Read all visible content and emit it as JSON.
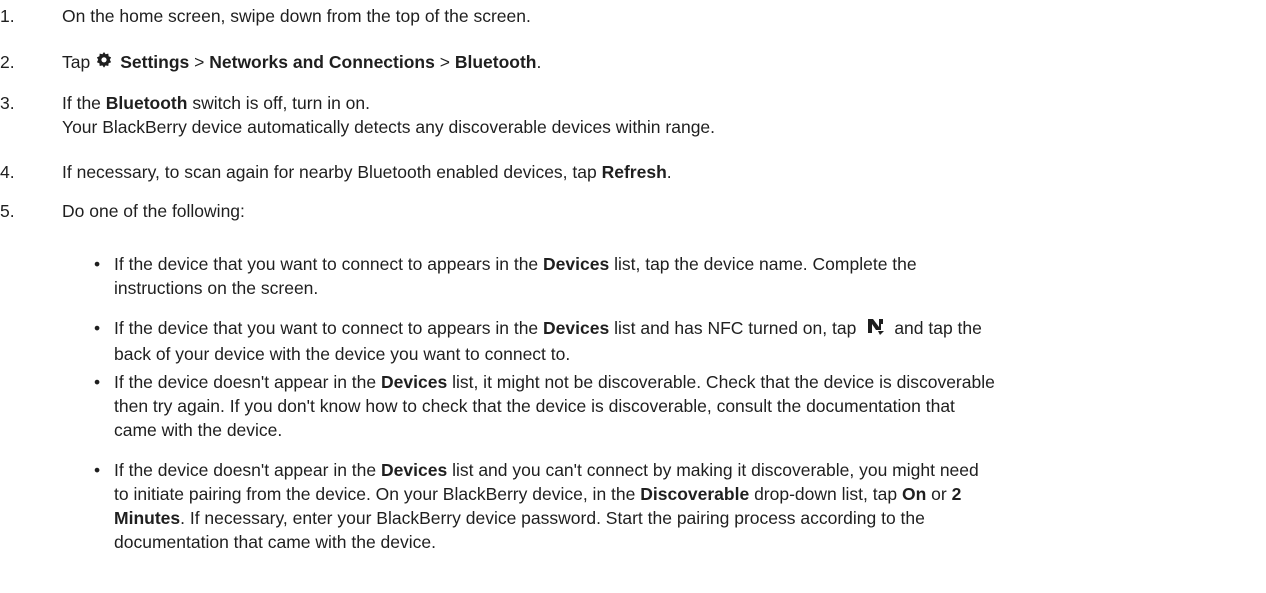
{
  "steps": [
    {
      "num": "1.",
      "text": "On the home screen, swipe down from the top of the screen."
    },
    {
      "num": "2.",
      "parts": [
        "Tap",
        "Settings",
        ">",
        "Networks and Connections",
        ">",
        "Bluetooth",
        "."
      ]
    },
    {
      "num": "3.",
      "parts": [
        "If the",
        "Bluetooth",
        "switch is off, turn in on."
      ],
      "line2": "Your BlackBerry device automatically detects any discoverable devices within range."
    },
    {
      "num": "4.",
      "parts": [
        "If necessary, to scan again for nearby Bluetooth enabled devices, tap",
        "Refresh",
        "."
      ]
    },
    {
      "num": "5.",
      "text": "Do one of the following:"
    }
  ],
  "bullets": [
    {
      "l1": [
        "If the device that you want to connect to appears in the",
        "Devices",
        "list, tap the device name. Complete the"
      ],
      "l2": "instructions on the screen."
    },
    {
      "l1": [
        "If the device that you want to connect to appears in the",
        "Devices",
        "list and has NFC turned on, tap",
        "and tap the"
      ],
      "l2": "back of your device with the device you want to connect to."
    },
    {
      "l1": [
        "If the device doesn't appear in the",
        "Devices",
        "list, it might not be discoverable. Check that the device is discoverable"
      ],
      "l2": "then try again. If you don't know how to check that the device is discoverable, consult the documentation that",
      "l3": "came with the device."
    },
    {
      "l1": [
        "If the device doesn't appear in the",
        "Devices",
        "list and you can't connect by making it discoverable, you might need"
      ],
      "l2": [
        "to initiate pairing from the device. On your BlackBerry device, in the",
        "Discoverable",
        "drop-down list, tap",
        "On",
        "or",
        "2"
      ],
      "l3": [
        "Minutes",
        ". If necessary, enter your BlackBerry device password. Start the pairing process according to the"
      ],
      "l4": "documentation that came with the device."
    }
  ],
  "bullet_char": "•",
  "icons": {
    "settings": "gear-icon",
    "nfc": "nfc-icon"
  }
}
